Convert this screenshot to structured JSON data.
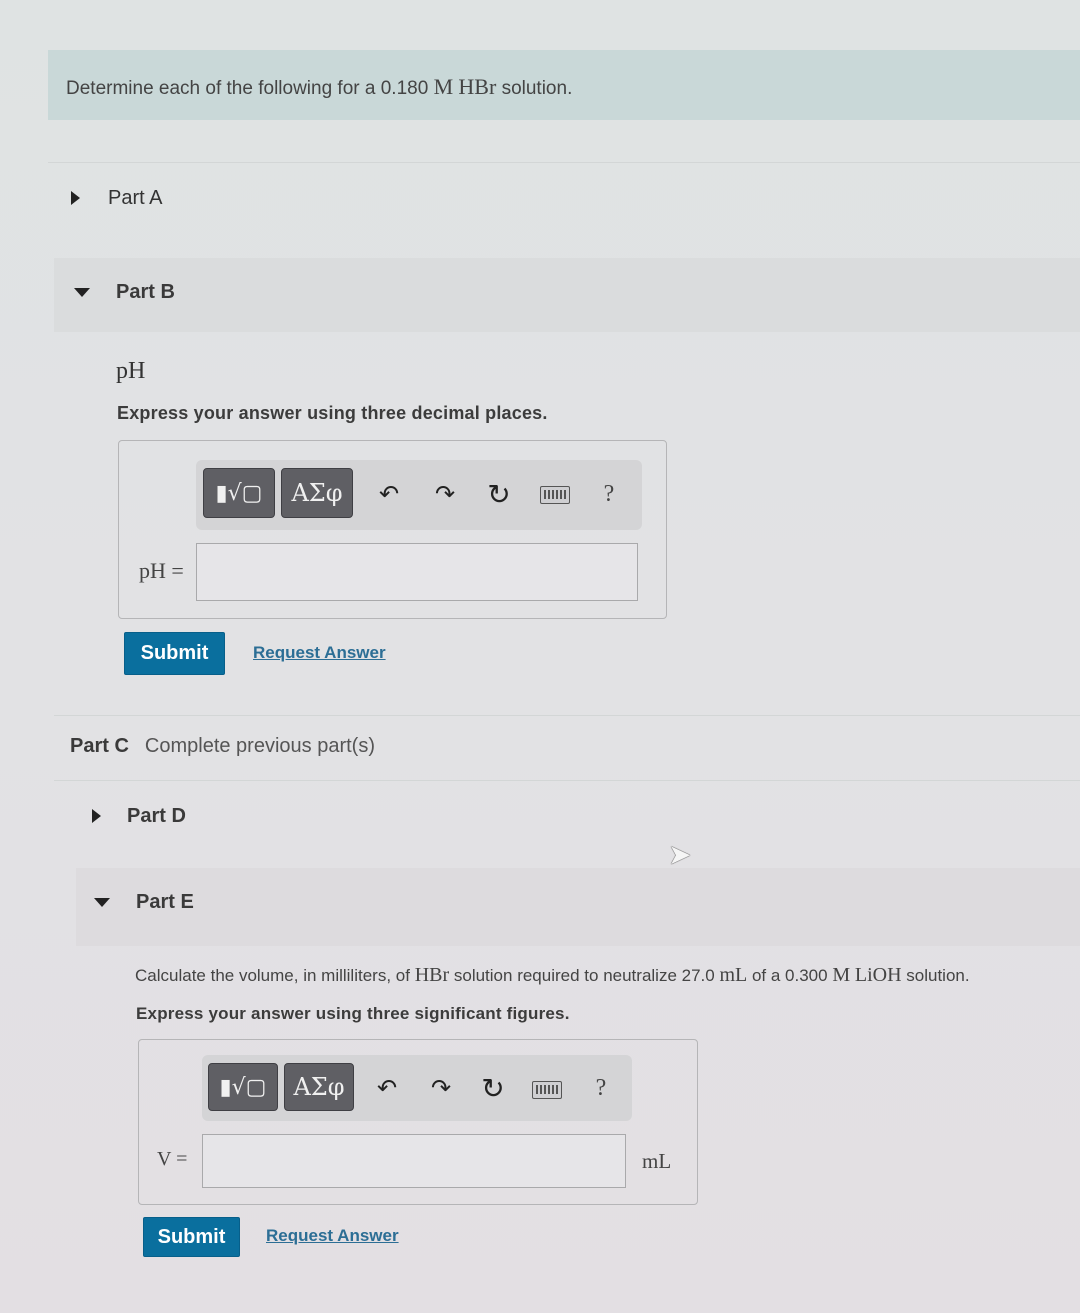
{
  "intro": {
    "prefix": "Determine each of the following for a 0.180",
    "molar": "M",
    "compound": "HBr",
    "suffix": "solution."
  },
  "parts": {
    "a": {
      "label": "Part A"
    },
    "b": {
      "label": "Part B",
      "question": "pH",
      "instruction": "Express your answer using three decimal places.",
      "field_label": "pH =",
      "field_value": "",
      "submit_label": "Submit",
      "request_label": "Request Answer"
    },
    "c": {
      "label": "Part C",
      "status": "Complete previous part(s)"
    },
    "d": {
      "label": "Part D"
    },
    "e": {
      "label": "Part E",
      "q_prefix": "Calculate the volume, in milliliters, of",
      "q_hbr": "HBr",
      "q_mid": "solution required to neutralize 27.0",
      "q_ml": "mL",
      "q_mid2": "of a 0.300",
      "q_m": "M",
      "q_lioh": "LiOH",
      "q_suffix": "solution.",
      "instruction": "Express your answer using three significant figures.",
      "field_label": "V =",
      "field_value": "",
      "unit": "mL",
      "submit_label": "Submit",
      "request_label": "Request Answer"
    }
  },
  "toolbar": {
    "templates_icon": "fraction-sqrt-templates-icon",
    "greek_label": "ΑΣφ",
    "undo_icon": "undo-icon",
    "redo_icon": "redo-icon",
    "reset_icon": "reset-icon",
    "keyboard_icon": "keyboard-icon",
    "help_label": "?"
  }
}
